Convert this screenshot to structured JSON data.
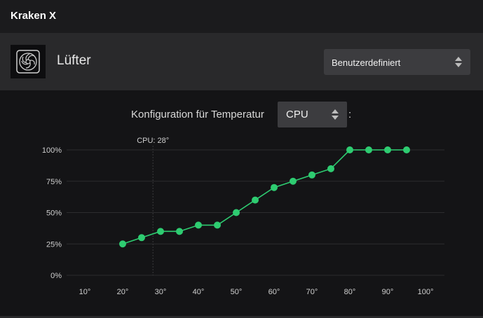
{
  "app": {
    "title": "Kraken X"
  },
  "header": {
    "icon": "fan-icon",
    "title": "Lüfter",
    "mode_select": {
      "value": "Benutzerdefiniert",
      "icon": "updown-icon"
    }
  },
  "config": {
    "label": "Konfiguration für Temperatur",
    "source_select": {
      "value": "CPU",
      "icon": "updown-icon"
    },
    "suffix": ":"
  },
  "colors": {
    "accent": "#2ecc71",
    "grid": "#2c2c2e",
    "marker": "#3a3a3c"
  },
  "chart_data": {
    "type": "line",
    "x_ticks": [
      "10°",
      "20°",
      "30°",
      "40°",
      "50°",
      "60°",
      "70°",
      "80°",
      "90°",
      "100°"
    ],
    "y_ticks": [
      "0%",
      "25%",
      "50%",
      "75%",
      "100%"
    ],
    "xlim": [
      10,
      100
    ],
    "ylim": [
      0,
      100
    ],
    "grid": true,
    "current_marker": {
      "x": 28,
      "label": "CPU: 28°"
    },
    "series": [
      {
        "x": [
          20,
          25,
          30,
          35,
          40,
          45,
          50,
          55,
          60,
          65,
          70,
          75,
          80,
          85,
          90,
          95
        ],
        "y": [
          25,
          30,
          35,
          35,
          40,
          40,
          50,
          60,
          70,
          75,
          80,
          85,
          100,
          100,
          100,
          100
        ]
      }
    ]
  }
}
